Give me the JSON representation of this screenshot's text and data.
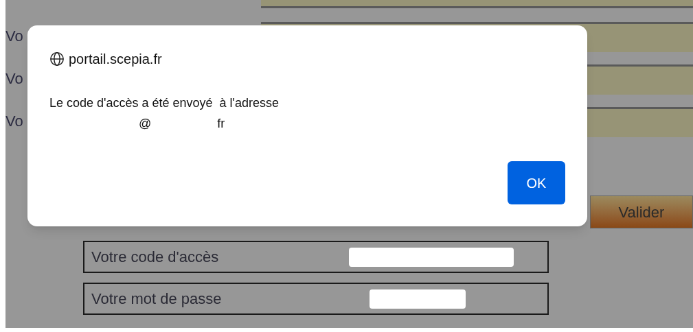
{
  "form": {
    "rows": [
      {
        "label": "Vo"
      },
      {
        "label": "Vo"
      },
      {
        "label": "Vo"
      }
    ],
    "submit": "Valider",
    "summary": [
      {
        "label": "Votre code d'accès"
      },
      {
        "label": "Votre mot de passe"
      }
    ]
  },
  "dialog": {
    "origin": "portail.scepia.fr",
    "message": "Le code d'accès a été envoyé  à l'adresse",
    "email_at": "@",
    "email_domain": "fr",
    "button": "OK"
  }
}
